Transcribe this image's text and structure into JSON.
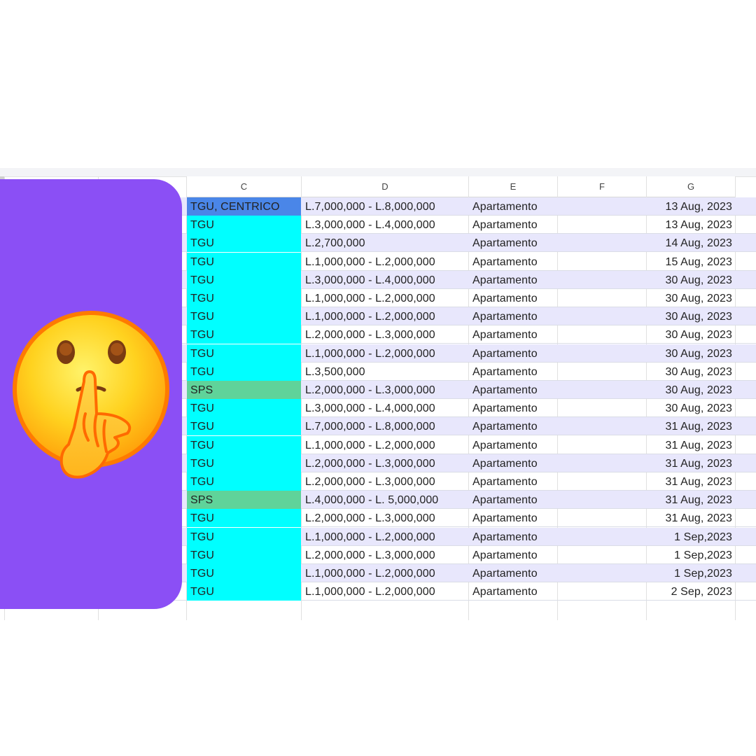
{
  "sheet": {
    "columns": [
      "C",
      "D",
      "E",
      "F",
      "G"
    ],
    "fill_colors": {
      "TGU": "#00ffff",
      "SPS": "#5fd39a",
      "TGU, CENTRICO": "#4a86e8",
      "band": "#e8e7fc"
    },
    "rows": [
      {
        "c": "TGU, CENTRICO",
        "d": "L.7,000,000 - L.8,000,000",
        "e": "Apartamento",
        "f": "",
        "g": "13 Aug, 2023"
      },
      {
        "c": "TGU",
        "d": "L.3,000,000 - L.4,000,000",
        "e": "Apartamento",
        "f": "",
        "g": "13 Aug, 2023"
      },
      {
        "c": "TGU",
        "d": "L.2,700,000",
        "e": "Apartamento",
        "f": "",
        "g": "14 Aug, 2023"
      },
      {
        "c": "TGU",
        "d": "L.1,000,000 - L.2,000,000",
        "e": "Apartamento",
        "f": "",
        "g": "15 Aug, 2023"
      },
      {
        "c": "TGU",
        "d": "L.3,000,000 - L.4,000,000",
        "e": "Apartamento",
        "f": "",
        "g": "30 Aug, 2023"
      },
      {
        "c": "TGU",
        "d": "L.1,000,000 - L.2,000,000",
        "e": "Apartamento",
        "f": "",
        "g": "30 Aug, 2023"
      },
      {
        "c": "TGU",
        "d": "L.1,000,000 - L.2,000,000",
        "e": "Apartamento",
        "f": "",
        "g": "30 Aug, 2023"
      },
      {
        "c": "TGU",
        "d": "L.2,000,000 - L.3,000,000",
        "e": "Apartamento",
        "f": "",
        "g": "30 Aug, 2023"
      },
      {
        "c": "TGU",
        "d": "L.1,000,000 - L.2,000,000",
        "e": "Apartamento",
        "f": "",
        "g": "30 Aug, 2023"
      },
      {
        "c": "TGU",
        "d": "L.3,500,000",
        "e": "Apartamento",
        "f": "",
        "g": "30 Aug, 2023"
      },
      {
        "c": "SPS",
        "d": "L.2,000,000 - L.3,000,000",
        "e": "Apartamento",
        "f": "",
        "g": "30 Aug, 2023"
      },
      {
        "c": "TGU",
        "d": "L.3,000,000 - L.4,000,000",
        "e": "Apartamento",
        "f": "",
        "g": "30 Aug, 2023"
      },
      {
        "c": "TGU",
        "d": "L.7,000,000 - L.8,000,000",
        "e": "Apartamento",
        "f": "",
        "g": "31 Aug, 2023"
      },
      {
        "c": "TGU",
        "d": "L.1,000,000 - L.2,000,000",
        "e": "Apartamento",
        "f": "",
        "g": "31 Aug, 2023"
      },
      {
        "c": "TGU",
        "d": "L.2,000,000 - L.3,000,000",
        "e": "Apartamento",
        "f": "",
        "g": "31 Aug, 2023"
      },
      {
        "c": "TGU",
        "d": "L.2,000,000 - L.3,000,000",
        "e": "Apartamento",
        "f": "",
        "g": "31 Aug, 2023"
      },
      {
        "c": "SPS",
        "d": "L.4,000,000 - L. 5,000,000",
        "e": "Apartamento",
        "f": "",
        "g": "31 Aug, 2023"
      },
      {
        "c": "TGU",
        "d": "L.2,000,000 - L.3,000,000",
        "e": "Apartamento",
        "f": "",
        "g": "31 Aug, 2023"
      },
      {
        "c": "TGU",
        "d": "L.1,000,000 - L.2,000,000",
        "e": "Apartamento",
        "f": "",
        "g": "1 Sep,2023"
      },
      {
        "c": "TGU",
        "d": "L.2,000,000 - L.3,000,000",
        "e": "Apartamento",
        "f": "",
        "g": "1 Sep,2023"
      },
      {
        "c": "TGU",
        "d": "L.1,000,000 - L.2,000,000",
        "e": "Apartamento",
        "f": "",
        "g": "1 Sep,2023"
      },
      {
        "c": "TGU",
        "d": "L.1,000,000 - L.2,000,000",
        "e": "Apartamento",
        "f": "",
        "g": "2 Sep, 2023"
      }
    ]
  },
  "overlay": {
    "color": "#8b4ff5",
    "emoji": "shushing-face-icon"
  }
}
